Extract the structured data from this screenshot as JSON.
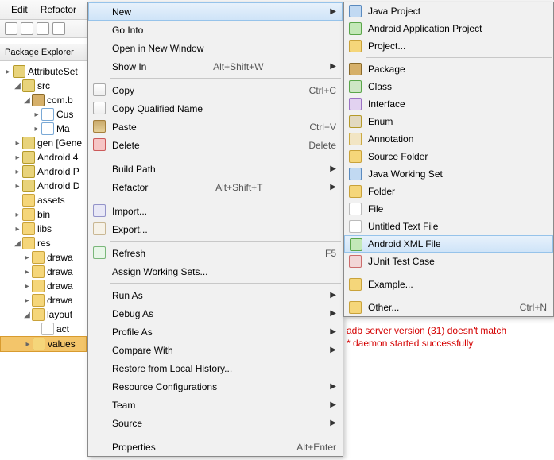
{
  "menubar": [
    "Edit",
    "Refactor"
  ],
  "paneTitle": "Package Explorer",
  "tree": [
    {
      "d": 0,
      "tw": "▸",
      "ic": "ic-proj",
      "label": "AttributeSet"
    },
    {
      "d": 1,
      "tw": "◢",
      "ic": "ic-src",
      "label": "src"
    },
    {
      "d": 2,
      "tw": "◢",
      "ic": "ic-pkg",
      "label": "com.b"
    },
    {
      "d": 3,
      "tw": "▸",
      "ic": "ic-j",
      "label": "Cus"
    },
    {
      "d": 3,
      "tw": "▸",
      "ic": "ic-j",
      "label": "Ma"
    },
    {
      "d": 1,
      "tw": "▸",
      "ic": "ic-src",
      "label": "gen [Gene"
    },
    {
      "d": 1,
      "tw": "▸",
      "ic": "ic-src",
      "label": "Android 4"
    },
    {
      "d": 1,
      "tw": "▸",
      "ic": "ic-src",
      "label": "Android P"
    },
    {
      "d": 1,
      "tw": "▸",
      "ic": "ic-src",
      "label": "Android D"
    },
    {
      "d": 1,
      "tw": "",
      "ic": "ic-fld",
      "label": "assets"
    },
    {
      "d": 1,
      "tw": "▸",
      "ic": "ic-fld",
      "label": "bin"
    },
    {
      "d": 1,
      "tw": "▸",
      "ic": "ic-fld",
      "label": "libs"
    },
    {
      "d": 1,
      "tw": "◢",
      "ic": "ic-fld",
      "label": "res"
    },
    {
      "d": 2,
      "tw": "▸",
      "ic": "ic-fld",
      "label": "drawa"
    },
    {
      "d": 2,
      "tw": "▸",
      "ic": "ic-fld",
      "label": "drawa"
    },
    {
      "d": 2,
      "tw": "▸",
      "ic": "ic-fld",
      "label": "drawa"
    },
    {
      "d": 2,
      "tw": "▸",
      "ic": "ic-fld",
      "label": "drawa"
    },
    {
      "d": 2,
      "tw": "◢",
      "ic": "ic-fld",
      "label": "layout"
    },
    {
      "d": 3,
      "tw": "",
      "ic": "ic-file",
      "label": "act"
    },
    {
      "d": 2,
      "tw": "▸",
      "ic": "ic-fld",
      "label": "values",
      "sel": true
    }
  ],
  "context": [
    {
      "label": "New",
      "arrow": true,
      "hl": true
    },
    {
      "label": "Go Into"
    },
    {
      "label": "Open in New Window"
    },
    {
      "label": "Show In",
      "accel": "Alt+Shift+W",
      "arrow": true
    },
    {
      "sep": true
    },
    {
      "icon": "i-copy",
      "label": "Copy",
      "accel": "Ctrl+C"
    },
    {
      "icon": "i-copy",
      "label": "Copy Qualified Name"
    },
    {
      "icon": "i-paste",
      "label": "Paste",
      "accel": "Ctrl+V"
    },
    {
      "icon": "i-del",
      "label": "Delete",
      "accel": "Delete"
    },
    {
      "sep": true
    },
    {
      "label": "Build Path",
      "arrow": true
    },
    {
      "label": "Refactor",
      "accel": "Alt+Shift+T",
      "arrow": true
    },
    {
      "sep": true
    },
    {
      "icon": "i-import",
      "label": "Import..."
    },
    {
      "icon": "i-export",
      "label": "Export..."
    },
    {
      "sep": true
    },
    {
      "icon": "i-refresh",
      "label": "Refresh",
      "accel": "F5"
    },
    {
      "label": "Assign Working Sets..."
    },
    {
      "sep": true
    },
    {
      "label": "Run As",
      "arrow": true
    },
    {
      "label": "Debug As",
      "arrow": true
    },
    {
      "label": "Profile As",
      "arrow": true
    },
    {
      "label": "Compare With",
      "arrow": true
    },
    {
      "label": "Restore from Local History..."
    },
    {
      "label": "Resource Configurations",
      "arrow": true
    },
    {
      "label": "Team",
      "arrow": true
    },
    {
      "label": "Source",
      "arrow": true
    },
    {
      "sep": true
    },
    {
      "label": "Properties",
      "accel": "Alt+Enter"
    }
  ],
  "submenu": [
    {
      "icon": "i-java",
      "label": "Java Project"
    },
    {
      "icon": "i-android",
      "label": "Android Application Project"
    },
    {
      "icon": "i-folder",
      "label": "Project..."
    },
    {
      "sep": true
    },
    {
      "icon": "i-pkg",
      "label": "Package"
    },
    {
      "icon": "i-class",
      "label": "Class"
    },
    {
      "icon": "i-if",
      "label": "Interface"
    },
    {
      "icon": "i-enum",
      "label": "Enum"
    },
    {
      "icon": "i-ann",
      "label": "Annotation"
    },
    {
      "icon": "i-folder",
      "label": "Source Folder"
    },
    {
      "icon": "i-java",
      "label": "Java Working Set"
    },
    {
      "icon": "i-folder",
      "label": "Folder"
    },
    {
      "icon": "i-file",
      "label": "File"
    },
    {
      "icon": "i-file",
      "label": "Untitled Text File"
    },
    {
      "icon": "i-android",
      "label": "Android XML File",
      "hl": true
    },
    {
      "icon": "i-junit",
      "label": "JUnit Test Case"
    },
    {
      "sep": true
    },
    {
      "icon": "i-folder",
      "label": "Example..."
    },
    {
      "sep": true
    },
    {
      "icon": "i-folder",
      "label": "Other...",
      "accel": "Ctrl+N"
    }
  ],
  "console": {
    "line1": "adb server version (31) doesn't match",
    "line2": "* daemon started successfully"
  }
}
